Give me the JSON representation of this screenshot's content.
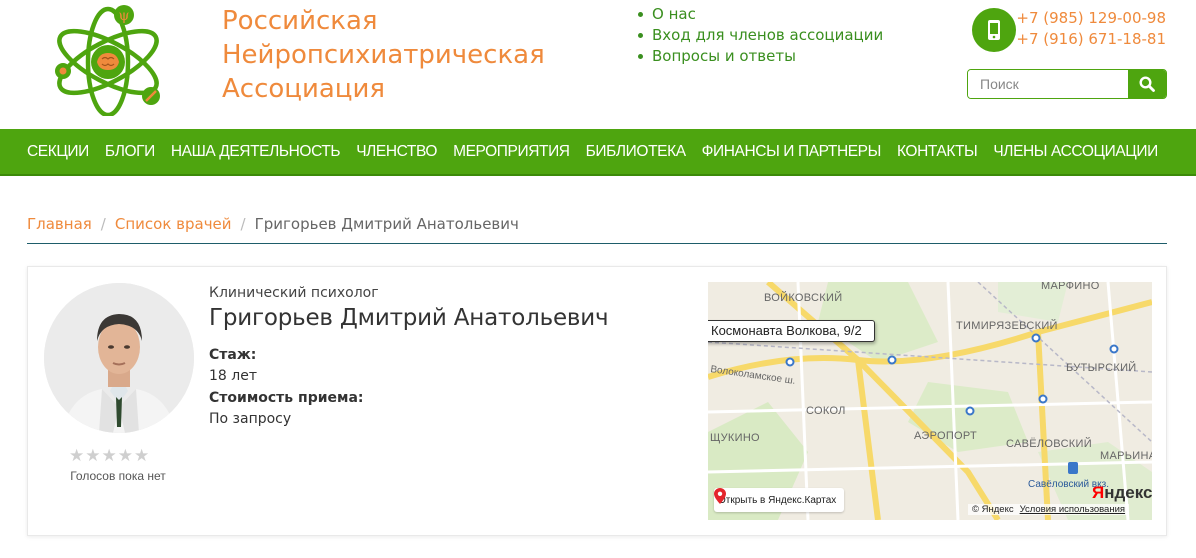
{
  "header": {
    "site_title": [
      "Российская",
      "Нейропсихиатрическая",
      "Ассоциация"
    ],
    "top_links": [
      "О нас",
      "Вход для членов ассоциации",
      "Вопросы и ответы"
    ],
    "phones": [
      "+7 (985) 129-00-98",
      "+7 (916) 671-18-81"
    ],
    "search_placeholder": "Поиск"
  },
  "nav": {
    "items": [
      "СЕКЦИИ",
      "БЛОГИ",
      "НАША ДЕЯТЕЛЬНОСТЬ",
      "ЧЛЕНСТВО",
      "МЕРОПРИЯТИЯ",
      "БИБЛИОТЕКА",
      "ФИНАНСЫ И ПАРТНЕРЫ",
      "КОНТАКТЫ",
      "ЧЛЕНЫ АССОЦИАЦИИ"
    ]
  },
  "breadcrumb": {
    "home": "Главная",
    "list": "Список врачей",
    "current": "Григорьев Дмитрий Анатольевич"
  },
  "doctor": {
    "specialty": "Клинический психолог",
    "name": "Григорьев Дмитрий Анатольевич",
    "experience_label": "Стаж:",
    "experience_value": "18 лет",
    "price_label": "Стоимость приема:",
    "price_value": "По запросу",
    "rating_stars": 0,
    "rating_max": 5,
    "votes_text": "Голосов пока нет"
  },
  "map": {
    "address": "Космонавта Волкова, 9/2",
    "districts": [
      "ВОЙКОВСКИЙ",
      "МАРФИНО",
      "ТИМИРЯЗЕВСКИЙ",
      "БУТЫРСКИЙ",
      "СОКОЛ",
      "АЭРОПОРТ",
      "САВЁЛОВСКИЙ",
      "ЩУКИНО",
      "МАРЬИНА"
    ],
    "road_label": "Волоколамское ш.",
    "station_label": "Савёловский вкз.",
    "open_link": "Открыть в Яндекс.Картах",
    "brand_first": "Я",
    "brand_rest": "ндекс",
    "copyright": "© Яндекс",
    "terms": "Условия использования"
  },
  "colors": {
    "brand_green": "#4ea50f",
    "accent_orange": "#ef8a3c",
    "link_green": "#3a8f1f"
  }
}
